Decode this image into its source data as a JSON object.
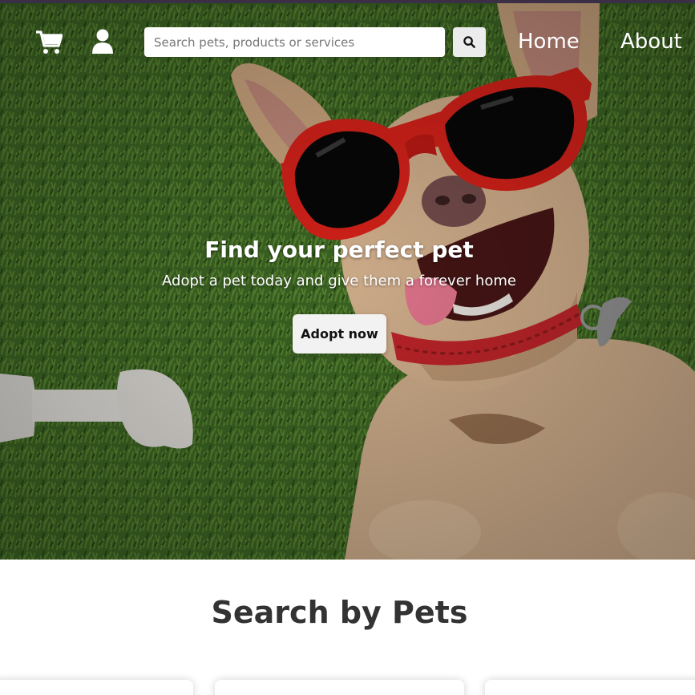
{
  "colors": {
    "nav_text": "#ffffff",
    "hero_button_bg": "#f2f2f2",
    "section_title": "#333333",
    "sunglasses_red": "#e0231b"
  },
  "header": {
    "cart_icon": "shopping-cart-icon",
    "user_icon": "user-icon",
    "search": {
      "placeholder": "Search pets, products or services",
      "value": "",
      "button_icon": "search-icon"
    },
    "nav": {
      "home": "Home",
      "about": "About"
    }
  },
  "hero": {
    "title": "Find your perfect pet",
    "subtitle": "Adopt a pet today and give them a forever home",
    "button_label": "Adopt now",
    "image_subject": "dog-with-red-sunglasses-on-grass"
  },
  "section": {
    "title": "Search by Pets",
    "cards": [
      {},
      {},
      {}
    ]
  }
}
